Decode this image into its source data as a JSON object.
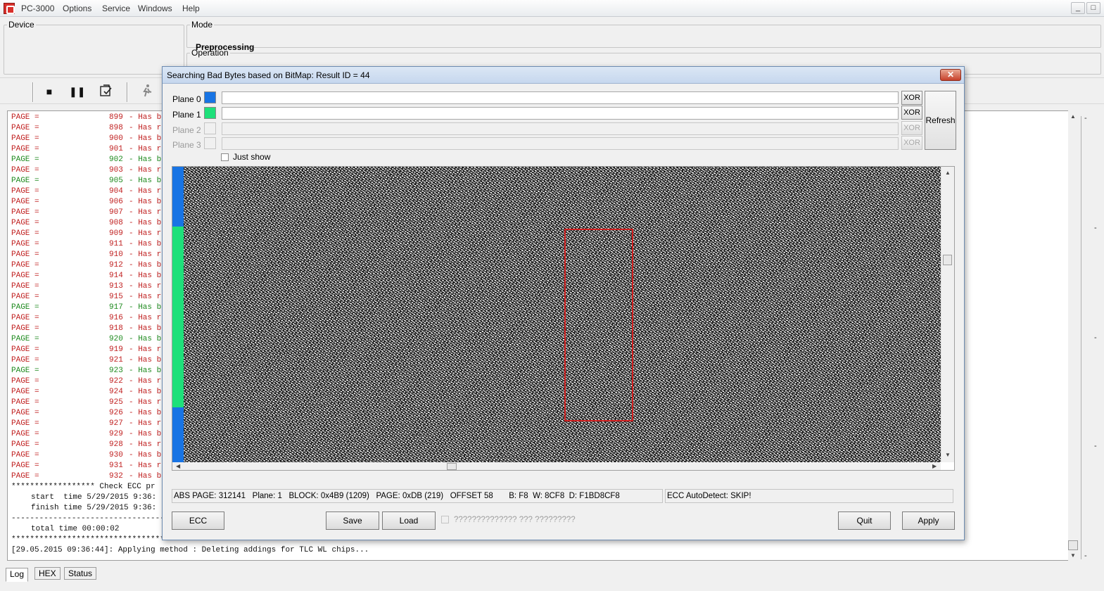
{
  "app": {
    "title": "PC-3000",
    "menu": [
      "Options",
      "Service",
      "Windows",
      "Help"
    ],
    "window_buttons": [
      "_",
      "□"
    ]
  },
  "panels": {
    "device_legend": "Device",
    "mode_legend": "Mode",
    "mode_value": "Preprocessing",
    "operation_legend": "Operation"
  },
  "log": {
    "page_lines": [
      {
        "label": "PAGE =",
        "num": "899",
        "text": "- Has b",
        "color": "red"
      },
      {
        "label": "PAGE =",
        "num": "898",
        "text": "- Has r",
        "color": "red"
      },
      {
        "label": "PAGE =",
        "num": "900",
        "text": "- Has b",
        "color": "red"
      },
      {
        "label": "PAGE =",
        "num": "901",
        "text": "- Has r",
        "color": "red"
      },
      {
        "label": "PAGE =",
        "num": "902",
        "text": "- Has b",
        "color": "green"
      },
      {
        "label": "PAGE =",
        "num": "903",
        "text": "- Has r",
        "color": "red"
      },
      {
        "label": "PAGE =",
        "num": "905",
        "text": "- Has b",
        "color": "green"
      },
      {
        "label": "PAGE =",
        "num": "904",
        "text": "- Has r",
        "color": "red"
      },
      {
        "label": "PAGE =",
        "num": "906",
        "text": "- Has b",
        "color": "red"
      },
      {
        "label": "PAGE =",
        "num": "907",
        "text": "- Has r",
        "color": "red"
      },
      {
        "label": "PAGE =",
        "num": "908",
        "text": "- Has b",
        "color": "red"
      },
      {
        "label": "PAGE =",
        "num": "909",
        "text": "- Has r",
        "color": "red"
      },
      {
        "label": "PAGE =",
        "num": "911",
        "text": "- Has b",
        "color": "red"
      },
      {
        "label": "PAGE =",
        "num": "910",
        "text": "- Has r",
        "color": "red"
      },
      {
        "label": "PAGE =",
        "num": "912",
        "text": "- Has b",
        "color": "red"
      },
      {
        "label": "PAGE =",
        "num": "914",
        "text": "- Has b",
        "color": "red"
      },
      {
        "label": "PAGE =",
        "num": "913",
        "text": "- Has r",
        "color": "red"
      },
      {
        "label": "PAGE =",
        "num": "915",
        "text": "- Has r",
        "color": "red"
      },
      {
        "label": "PAGE =",
        "num": "917",
        "text": "- Has b",
        "color": "green"
      },
      {
        "label": "PAGE =",
        "num": "916",
        "text": "- Has r",
        "color": "red"
      },
      {
        "label": "PAGE =",
        "num": "918",
        "text": "- Has b",
        "color": "red"
      },
      {
        "label": "PAGE =",
        "num": "920",
        "text": "- Has b",
        "color": "green"
      },
      {
        "label": "PAGE =",
        "num": "919",
        "text": "- Has r",
        "color": "red"
      },
      {
        "label": "PAGE =",
        "num": "921",
        "text": "- Has b",
        "color": "red"
      },
      {
        "label": "PAGE =",
        "num": "923",
        "text": "- Has b",
        "color": "green"
      },
      {
        "label": "PAGE =",
        "num": "922",
        "text": "- Has r",
        "color": "red"
      },
      {
        "label": "PAGE =",
        "num": "924",
        "text": "- Has b",
        "color": "red"
      },
      {
        "label": "PAGE =",
        "num": "925",
        "text": "- Has r",
        "color": "red"
      },
      {
        "label": "PAGE =",
        "num": "926",
        "text": "- Has b",
        "color": "red"
      },
      {
        "label": "PAGE =",
        "num": "927",
        "text": "- Has r",
        "color": "red"
      },
      {
        "label": "PAGE =",
        "num": "929",
        "text": "- Has b",
        "color": "red"
      },
      {
        "label": "PAGE =",
        "num": "928",
        "text": "- Has r",
        "color": "red"
      },
      {
        "label": "PAGE =",
        "num": "930",
        "text": "- Has b",
        "color": "red"
      },
      {
        "label": "PAGE =",
        "num": "931",
        "text": "- Has r",
        "color": "red"
      },
      {
        "label": "PAGE =",
        "num": "932",
        "text": "- Has b",
        "color": "red"
      }
    ],
    "check_line": "****************** Check ECC pr",
    "start_line": "start  time 5/29/2015 9:36:",
    "finish_line": "finish time 5/29/2015 9:36:",
    "dash_line": "--------------------------------------------------",
    "total_line": "total time 00:00:02",
    "star_line": "*********************************************************************************",
    "apply_line": "[29.05.2015 09:36:44]: Applying method : Deleting addings for TLC WL chips..."
  },
  "tabs": [
    "Log",
    "HEX",
    "Status"
  ],
  "dialog": {
    "title": "Searching Bad Bytes based on BitMap: Result ID = 44",
    "close_label": "✕",
    "planes": [
      {
        "label": "Plane 0",
        "color": "#1874e4",
        "enabled": true
      },
      {
        "label": "Plane 1",
        "color": "#1ee07a",
        "enabled": true
      },
      {
        "label": "Plane 2",
        "color": "#f0f0f0",
        "enabled": false
      },
      {
        "label": "Plane 3",
        "color": "#f0f0f0",
        "enabled": false
      }
    ],
    "xor_label": "XOR",
    "refresh_label": "Refresh",
    "just_show_label": "Just show",
    "status_left": "ABS PAGE: 312141   Plane: 1   BLOCK: 0x4B9 (1209)   PAGE: 0xDB (219)   OFFSET 58       B: F8  W: 8CF8  D: F1BD8CF8",
    "status_right": "ECC AutoDetect: SKIP!",
    "buttons": {
      "ecc": "ECC",
      "save": "Save",
      "load": "Load",
      "quit": "Quit",
      "apply": "Apply"
    },
    "unknown_option_label": "?????????????? ??? ?????????"
  },
  "colors": {
    "plane0": "#1874e4",
    "plane1": "#1ee07a",
    "highlight": "#d01f1f",
    "log_red": "#c02020",
    "log_green": "#1e8a1e"
  }
}
